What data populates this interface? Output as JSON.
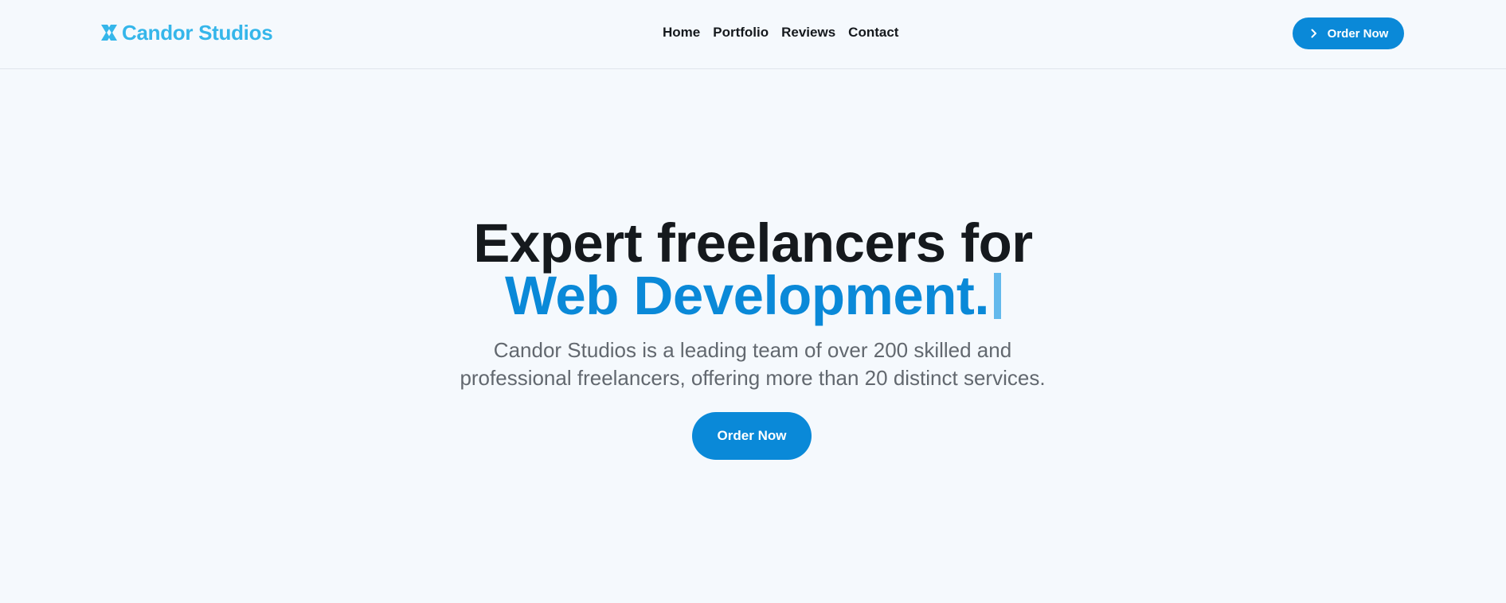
{
  "header": {
    "logo_text": "Candor Studios",
    "logo_icon": "x-mark-logo-icon",
    "nav": [
      "Home",
      "Portfolio",
      "Reviews",
      "Contact"
    ],
    "cta_label": "Order Now",
    "cta_icon": "chevron-right-icon"
  },
  "hero": {
    "title_line1": "Expert freelancers for",
    "title_line2": "Web Development.",
    "description_line1": "Candor Studios is a leading team of over 200 skilled and",
    "description_line2": "professional freelancers, offering more than 20 distinct services.",
    "cta_label": "Order Now"
  },
  "colors": {
    "background": "#f5f9fd",
    "brand_light": "#35b6ea",
    "accent": "#0a89d8",
    "heading": "#15191d",
    "body_text": "#62686f",
    "caret": "#63b9ec"
  }
}
